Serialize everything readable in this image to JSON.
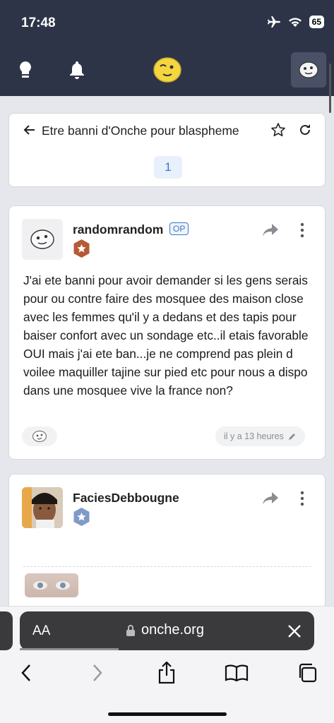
{
  "status_bar": {
    "time": "17:48",
    "battery": "65"
  },
  "header": {
    "icons": [
      "lightbulb-icon",
      "bell-icon",
      "onche-logo",
      "profile-face-icon"
    ],
    "bg": "#2e3448"
  },
  "topic": {
    "title": "Etre banni d'Onche pour blaspheme",
    "page": "1"
  },
  "posts": [
    {
      "username": "randomrandom",
      "badge": "OP",
      "body": "J'ai ete banni pour avoir demander si les gens serais pour ou contre faire des mosquee des maison close avec les femmes qu'il y a dedans et des tapis pour baiser confort avec un sondage etc..il etais favorable OUI mais j'ai ete ban...je ne comprend pas plein d voilee maquiller tajine sur pied etc pour nous a dispo dans une mosquee vive la france non?",
      "timestamp": "il y a 13 heures",
      "rank_color": "#b65a36"
    },
    {
      "username": "FaciesDebbougne",
      "rank_color": "#7f9ac7"
    }
  ],
  "browser": {
    "aa_label": "AA",
    "url": "onche.org"
  },
  "colors": {
    "accent": "#3d76c6",
    "page_bg": "#e6e7ec"
  }
}
